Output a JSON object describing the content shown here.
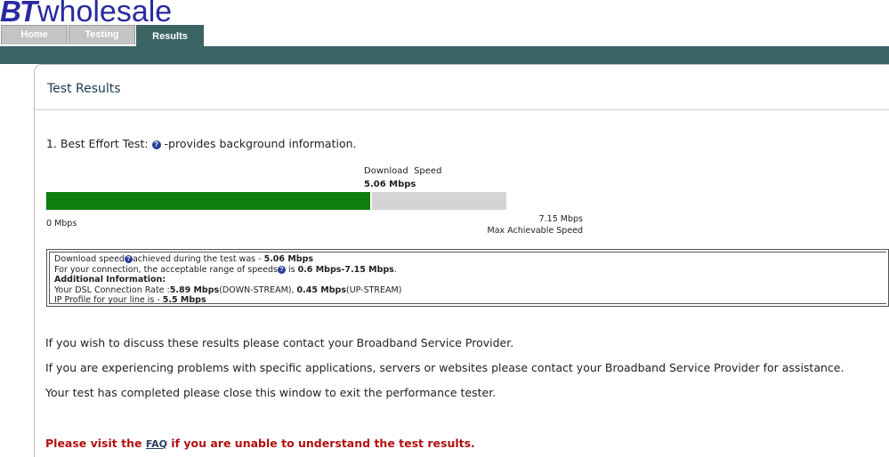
{
  "brand": {
    "bt": "BT",
    "wholesale": "wholesale"
  },
  "tabs": [
    {
      "label": "Home"
    },
    {
      "label": "Testing"
    },
    {
      "label": "Results"
    }
  ],
  "page": {
    "title": "Test Results"
  },
  "test": {
    "heading": "1. Best Effort Test:",
    "heading_suffix": "-provides background information.",
    "download_label": "Download  Speed",
    "download_value": "5.06 Mbps",
    "progress_fraction": 0.708,
    "min_label": "0 Mbps",
    "max_value": "7.15 Mbps",
    "max_label": "Max Achievable Speed"
  },
  "info": {
    "line1_prefix": "Download speed",
    "line1_mid": "achieved during the test was - ",
    "line1_value": "5.06 Mbps",
    "line2_prefix": "For your connection, the acceptable range of speeds",
    "line2_mid": " is ",
    "line2_value": "0.6 Mbps-7.15 Mbps",
    "line2_suffix": ".",
    "additional_heading": "Additional Information:",
    "line4_prefix": "Your DSL Connection Rate :",
    "down_value": "5.89 Mbps",
    "down_label": "(DOWN-STREAM), ",
    "up_value": "0.45 Mbps",
    "up_label": "(UP-STREAM)",
    "line5_prefix": "IP Profile for your line is - ",
    "line5_value": "5.5 Mbps"
  },
  "paragraphs": [
    "If you wish to discuss these results please contact your Broadband Service Provider.",
    "If you are experiencing problems with specific applications, servers or websites please contact your Broadband Service Provider for assistance.",
    "Your test has completed please close this window to exit the performance tester."
  ],
  "faq": {
    "prefix": "Please visit the ",
    "link": "FAQ",
    "suffix": " if you are unable to understand the test results."
  },
  "icons": {
    "help": "?"
  },
  "colors": {
    "brand": "#2a2aa0",
    "nav": "#3b6465",
    "progress": "#0d7f0d",
    "track": "#d4d4d4",
    "warning": "#b01010"
  }
}
